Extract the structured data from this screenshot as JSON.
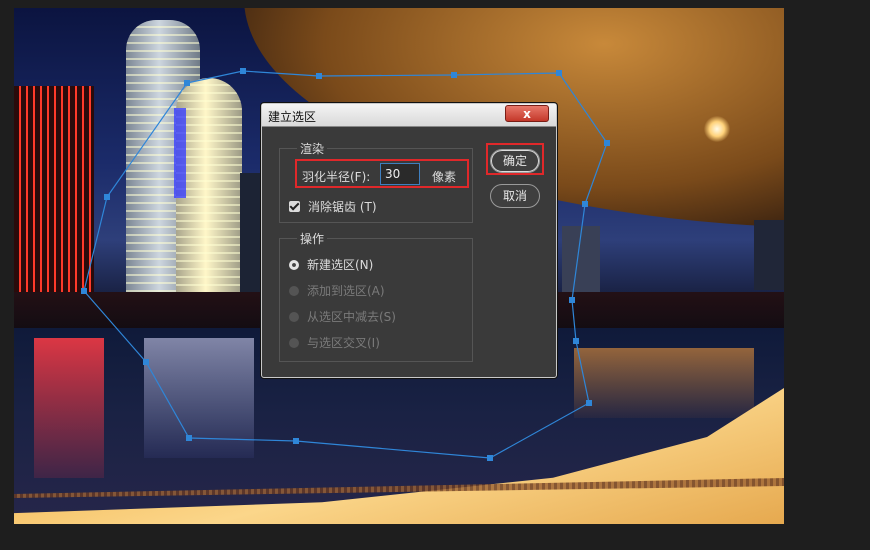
{
  "dialog": {
    "title": "建立选区",
    "close_label": "x",
    "render_group": {
      "label": "渲染",
      "feather_label": "羽化半径(F):",
      "feather_value": "30",
      "feather_unit": "像素",
      "antialias_label": "消除锯齿 (T)",
      "antialias_checked": true
    },
    "operation_group": {
      "label": "操作",
      "options": [
        {
          "label": "新建选区(N)",
          "selected": true,
          "enabled": true
        },
        {
          "label": "添加到选区(A)",
          "selected": false,
          "enabled": false
        },
        {
          "label": "从选区中减去(S)",
          "selected": false,
          "enabled": false
        },
        {
          "label": "与选区交叉(I)",
          "selected": false,
          "enabled": false
        }
      ]
    },
    "ok_label": "确定",
    "cancel_label": "取消"
  },
  "colors": {
    "highlight": "#e0282a",
    "selection_path": "#2f86d8",
    "dialog_bg": "#3a3a3a"
  }
}
